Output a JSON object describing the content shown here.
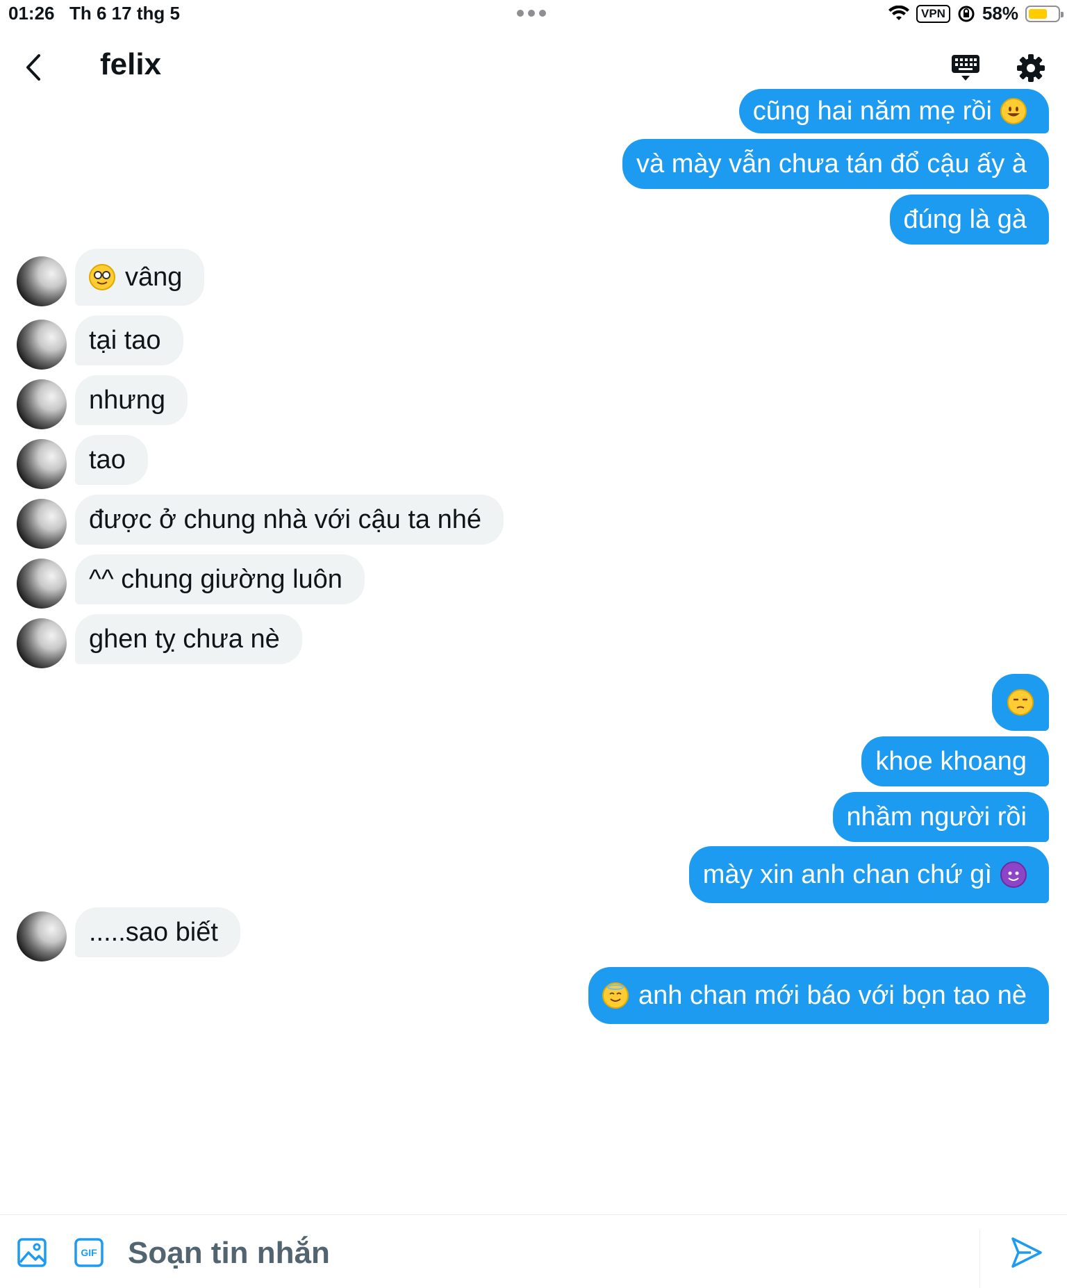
{
  "status_bar": {
    "time": "01:26",
    "date": "Th 6 17 thg 5",
    "vpn": "VPN",
    "battery": "58%",
    "battery_level": 0.58
  },
  "header": {
    "title": "felix"
  },
  "colors": {
    "accent": "#1d9bf0",
    "incoming_bubble": "#eff3f4",
    "battery_fill": "#ffcc00"
  },
  "messages": [
    {
      "dir": "out",
      "text": "cũng hai năm mẹ rồi",
      "emoji": "grinning-face"
    },
    {
      "dir": "out",
      "text": "và mày vẫn chưa tán đổ cậu ấy à"
    },
    {
      "dir": "out",
      "text": "đúng là gà"
    },
    {
      "dir": "in",
      "text": "vâng",
      "emoji": "nerd-face"
    },
    {
      "dir": "in",
      "text": "tại tao"
    },
    {
      "dir": "in",
      "text": "nhưng"
    },
    {
      "dir": "in",
      "text": "tao"
    },
    {
      "dir": "in",
      "text": "được ở chung nhà với cậu ta nhé"
    },
    {
      "dir": "in",
      "text": "^^ chung giường luôn"
    },
    {
      "dir": "in",
      "text": "ghen tỵ chưa nè"
    },
    {
      "dir": "out",
      "text": "",
      "emoji": "unamused-face"
    },
    {
      "dir": "out",
      "text": "khoe khoang"
    },
    {
      "dir": "out",
      "text": "nhầm người rồi"
    },
    {
      "dir": "out",
      "text": "mày xin anh chan chứ gì",
      "emoji": "smiling-imp"
    },
    {
      "dir": "in",
      "text": ".....sao biết"
    },
    {
      "dir": "out",
      "text": "anh chan mới báo với bọn tao nè",
      "emoji": "smiling-face-with-halo"
    }
  ],
  "composer": {
    "placeholder": "Soạn tin nhắn",
    "gif_label": "GIF"
  }
}
